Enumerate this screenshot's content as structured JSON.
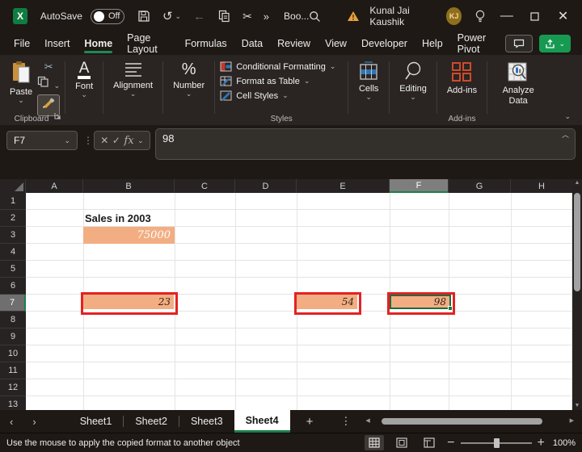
{
  "titlebar": {
    "app_name": "Excel",
    "logo_letter": "X",
    "autosave_label": "AutoSave",
    "autosave_state": "Off",
    "doc_name": "Boo...",
    "user_name": "Kunal Jai Kaushik",
    "user_initials": "KJ"
  },
  "menubar": {
    "tabs": [
      "File",
      "Insert",
      "Home",
      "Page Layout",
      "Formulas",
      "Data",
      "Review",
      "View",
      "Developer",
      "Help",
      "Power Pivot"
    ],
    "active_tab": "Home"
  },
  "ribbon": {
    "paste_label": "Paste",
    "clipboard_group_label": "Clipboard",
    "font_label": "Font",
    "font_glyph": "A",
    "alignment_label": "Alignment",
    "number_label": "Number",
    "number_glyph": "%",
    "conditional_formatting_label": "Conditional Formatting",
    "format_as_table_label": "Format as Table",
    "cell_styles_label": "Cell Styles",
    "styles_group_label": "Styles",
    "cells_label": "Cells",
    "editing_label": "Editing",
    "addins_label": "Add-ins",
    "addins_group_label": "Add-ins",
    "analyze_data_label": "Analyze Data"
  },
  "formula_bar": {
    "name_box": "F7",
    "fx_label": "fx",
    "formula": "98"
  },
  "grid": {
    "columns": [
      "A",
      "B",
      "C",
      "D",
      "E",
      "F",
      "G",
      "H"
    ],
    "selected_column": "F",
    "rows": [
      "1",
      "2",
      "3",
      "4",
      "5",
      "6",
      "7",
      "8",
      "9",
      "10",
      "11",
      "12",
      "13"
    ],
    "selected_row": "7",
    "cells": {
      "b2": "Sales in 2003",
      "b3": "75000",
      "b7": "23",
      "d7": "54",
      "f7": "98"
    }
  },
  "sheet_tabs": {
    "tabs": [
      "Sheet1",
      "Sheet2",
      "Sheet3",
      "Sheet4"
    ],
    "active": "Sheet4",
    "new_sheet": "+"
  },
  "status_bar": {
    "message": "Use the mouse to apply the copied format to another object",
    "zoom_level": "100%"
  },
  "icons": {
    "cut": "✂",
    "more_commands": "»",
    "undo": "↺",
    "back": "←",
    "chevron_down": "⌄",
    "chevron_up": "︿",
    "dots_vertical": "⋮",
    "minimize": "—",
    "close": "✕",
    "cancel": "✕",
    "enter": "✓",
    "tab_left": "‹",
    "tab_right": "›",
    "scroll_left": "◀",
    "scroll_right": "▶",
    "scroll_up": "▲",
    "scroll_down": "▼",
    "zoom_out": "−",
    "zoom_in": "+"
  },
  "colors": {
    "excel_green": "#107C41",
    "cell_fill_orange": "#F2AE82",
    "highlight_border_red": "#E32222"
  }
}
